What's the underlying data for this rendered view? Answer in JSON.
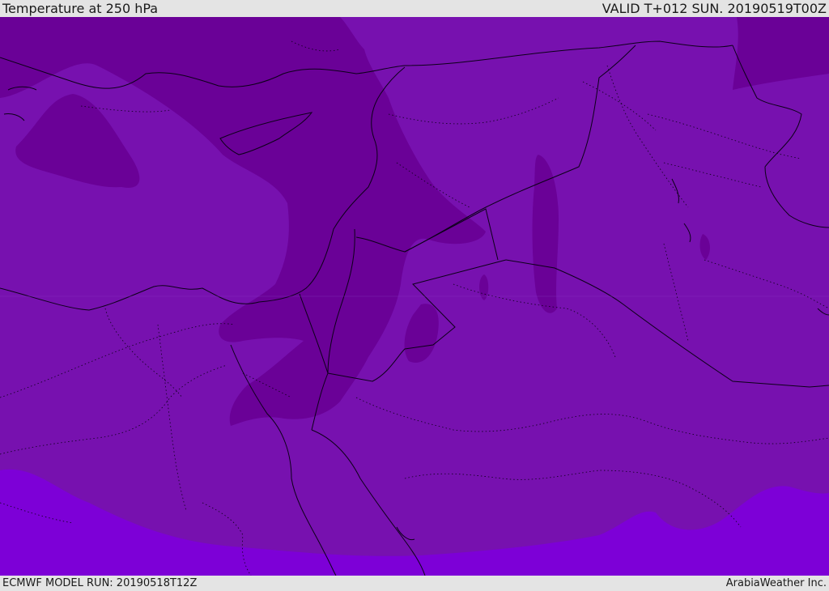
{
  "header": {
    "title": "Temperature at 250 hPa",
    "valid": "VALID T+012 SUN. 20190519T00Z"
  },
  "footer": {
    "model_run": "ECMWF MODEL RUN: 20190518T12Z",
    "credit": "ArabiaWeather Inc."
  },
  "colors": {
    "band_cold": "#6a0197",
    "band_mid": "#7711af",
    "band_warm": "#7d00d7",
    "boundary_line": "#0c0018"
  }
}
